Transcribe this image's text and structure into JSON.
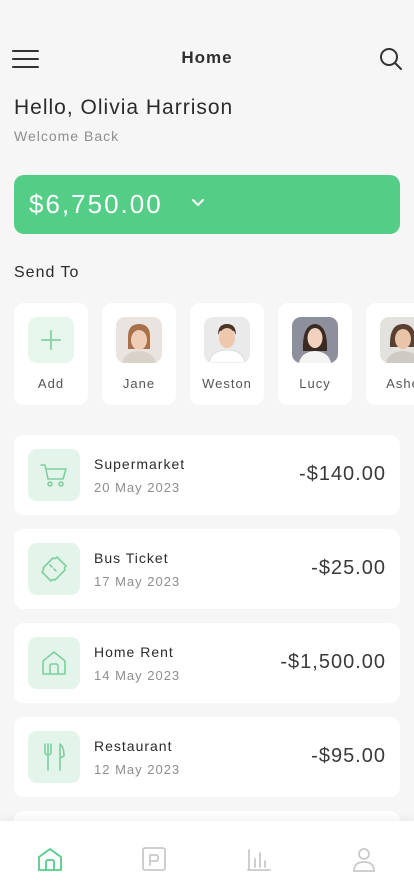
{
  "header": {
    "title": "Home",
    "menu_icon": "hamburger-menu-icon",
    "search_icon": "search-icon"
  },
  "greeting": {
    "hello": "Hello, Olivia Harrison",
    "subtitle": "Welcome Back"
  },
  "balance": {
    "amount": "$6,750.00",
    "icon": "chevron-down-icon"
  },
  "send_to": {
    "title": "Send To",
    "add_label": "Add",
    "contacts": [
      {
        "name": "Jane"
      },
      {
        "name": "Weston"
      },
      {
        "name": "Lucy"
      },
      {
        "name": "Ashe"
      }
    ]
  },
  "transactions": [
    {
      "name": "Supermarket",
      "date": "20 May 2023",
      "amount": "-$140.00",
      "icon": "shopping-cart-icon"
    },
    {
      "name": "Bus Ticket",
      "date": "17 May 2023",
      "amount": "-$25.00",
      "icon": "ticket-icon"
    },
    {
      "name": "Home Rent",
      "date": "14 May 2023",
      "amount": "-$1,500.00",
      "icon": "house-icon"
    },
    {
      "name": "Restaurant",
      "date": "12 May 2023",
      "amount": "-$95.00",
      "icon": "fork-knife-icon"
    }
  ],
  "bottom_nav": [
    {
      "icon": "home-icon",
      "active": true
    },
    {
      "icon": "wallet-icon",
      "active": false
    },
    {
      "icon": "bar-chart-icon",
      "active": false
    },
    {
      "icon": "user-icon",
      "active": false
    }
  ],
  "colors": {
    "accent": "#54cd87",
    "icon_bg": "#e3f5ea",
    "icon_stroke": "#7fcf9f",
    "inactive_nav": "#c9c9c9"
  }
}
